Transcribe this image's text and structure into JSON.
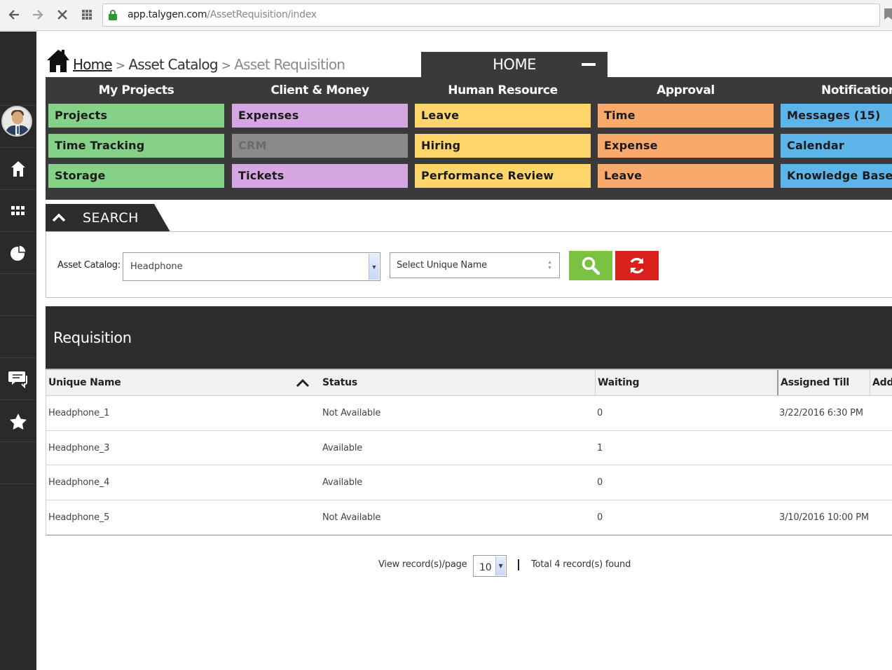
{
  "browser": {
    "url_host": "app.talygen.com",
    "url_path": "/AssetRequisition/index"
  },
  "breadcrumb": {
    "home": "Home",
    "sep": ">",
    "catalog": "Asset Catalog",
    "current": "Asset Requisition"
  },
  "home_tab": {
    "label": "HOME"
  },
  "menu": [
    {
      "heading": "My Projects",
      "color": "#86d188",
      "items": [
        "Projects",
        "Time Tracking",
        "Storage"
      ]
    },
    {
      "heading": "Client & Money",
      "color": "#d5a6e2",
      "items": [
        "Expenses",
        "CRM",
        "Tickets"
      ]
    },
    {
      "heading": "Human Resource",
      "color": "#fdd56b",
      "items": [
        "Leave",
        "Hiring",
        "Performance Review"
      ]
    },
    {
      "heading": "Approval",
      "color": "#f9a96b",
      "items": [
        "Time",
        "Expense",
        "Leave"
      ]
    },
    {
      "heading": "Notifications",
      "color": "#5db4e9",
      "items": [
        "Messages (15)",
        "Calendar",
        "Knowledge Base"
      ]
    }
  ],
  "search": {
    "tab_label": "SEARCH",
    "asset_catalog_label": "Asset Catalog:",
    "asset_catalog_value": "Headphone",
    "unique_name_placeholder": "Select Unique Name",
    "search_color": "#7cc242",
    "reset_color": "#d9201c"
  },
  "requisition": {
    "title": "Requisition",
    "columns": [
      "Unique Name",
      "Status",
      "Waiting",
      "Assigned Till",
      "Add"
    ],
    "rows": [
      {
        "unique_name": "Headphone_1",
        "status": "Not Available",
        "waiting": "0",
        "assigned_till": "3/22/2016 6:30 PM"
      },
      {
        "unique_name": "Headphone_3",
        "status": "Available",
        "waiting": "1",
        "assigned_till": ""
      },
      {
        "unique_name": "Headphone_4",
        "status": "Available",
        "waiting": "0",
        "assigned_till": ""
      },
      {
        "unique_name": "Headphone_5",
        "status": "Not Available",
        "waiting": "0",
        "assigned_till": "3/10/2016 10:00 PM"
      }
    ]
  },
  "pager": {
    "label": "View record(s)/page",
    "page_size": "10",
    "total": "Total 4 record(s) found"
  },
  "sidebar": {
    "icons": [
      "avatar",
      "home-icon",
      "apps-grid-icon",
      "pie-chart-icon",
      "chat-icon",
      "star-icon"
    ]
  }
}
